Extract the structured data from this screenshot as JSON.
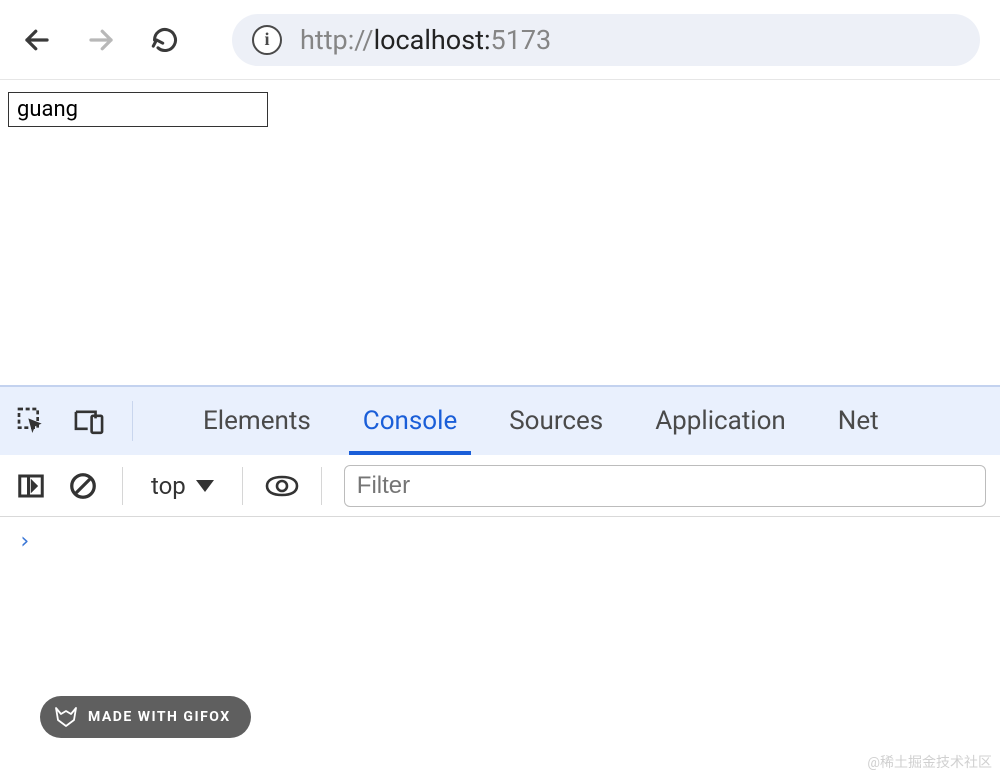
{
  "nav": {
    "url_prefix": "http://",
    "url_host": "localhost:",
    "url_port": "5173"
  },
  "page": {
    "input_value": "guang"
  },
  "devtools_tabs": {
    "elements": "Elements",
    "console": "Console",
    "sources": "Sources",
    "application": "Application",
    "network": "Net"
  },
  "console_toolbar": {
    "context_label": "top",
    "filter_placeholder": "Filter"
  },
  "console": {
    "prompt": "›"
  },
  "gifox": {
    "label": "MADE WITH GIFOX"
  },
  "watermark": {
    "text": "@稀土掘金技术社区"
  }
}
